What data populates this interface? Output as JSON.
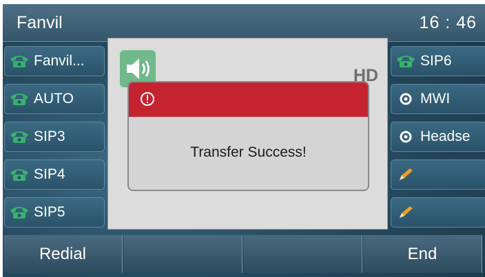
{
  "titlebar": {
    "account": "Fanvil",
    "time": "16 : 46"
  },
  "left_keys": [
    {
      "label": "Fanvil...",
      "icon": "phone-line-icon"
    },
    {
      "label": "AUTO",
      "icon": "phone-line-icon"
    },
    {
      "label": "SIP3",
      "icon": "phone-line-icon"
    },
    {
      "label": "SIP4",
      "icon": "phone-line-icon"
    },
    {
      "label": "SIP5",
      "icon": "phone-line-icon"
    }
  ],
  "right_keys": [
    {
      "label": "SIP6",
      "icon": "phone-line-icon"
    },
    {
      "label": "MWI",
      "icon": "voicemail-icon"
    },
    {
      "label": "Headse",
      "icon": "headset-icon"
    },
    {
      "label": "",
      "icon": "pencil-icon"
    },
    {
      "label": "",
      "icon": "pencil-icon"
    }
  ],
  "call": {
    "audio_icon": "speaker-icon",
    "quality": "HD"
  },
  "dialog": {
    "icon": "alert-icon",
    "message": "Transfer Success!"
  },
  "softkeys": [
    "Redial",
    "",
    "",
    "End"
  ],
  "colors": {
    "dialog_header": "#c5232f",
    "line_icon": "#37b26d",
    "speaker_bg": "#6fb98a"
  }
}
